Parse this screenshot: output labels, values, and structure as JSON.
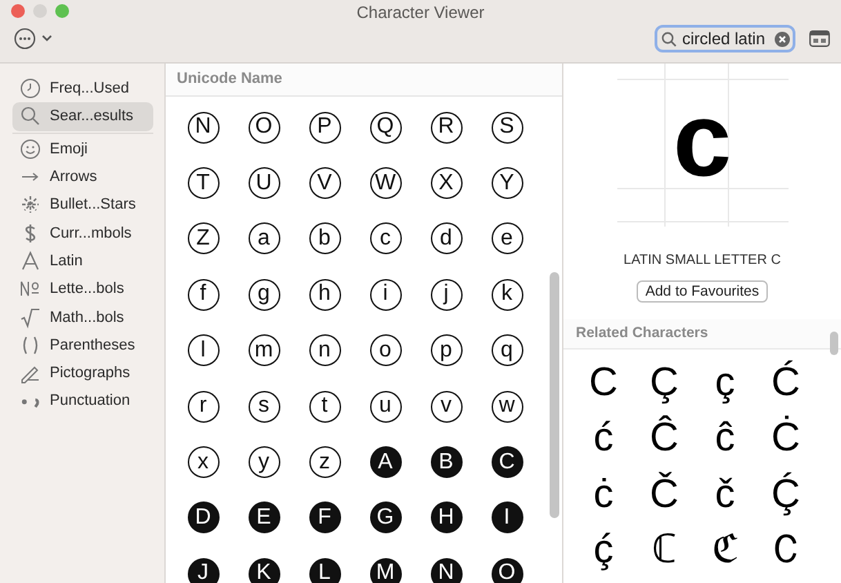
{
  "window": {
    "title": "Character Viewer"
  },
  "toolbar": {
    "search": {
      "value": "circled latin"
    }
  },
  "sidebar": {
    "items": [
      {
        "label": "Freq...Used",
        "kind": "clock",
        "selected": false
      },
      {
        "label": "Sear...esults",
        "kind": "search",
        "selected": true
      },
      {
        "label": "Emoji",
        "kind": "smiley",
        "selected": false
      },
      {
        "label": "Arrows",
        "kind": "arrow",
        "selected": false
      },
      {
        "label": "Bullet...Stars",
        "kind": "asterisk",
        "selected": false
      },
      {
        "label": "Curr...mbols",
        "kind": "dollar",
        "selected": false
      },
      {
        "label": "Latin",
        "kind": "letter",
        "selected": false
      },
      {
        "label": "Lette...bols",
        "kind": "numero",
        "selected": false
      },
      {
        "label": "Math...bols",
        "kind": "root",
        "selected": false
      },
      {
        "label": "Parentheses",
        "kind": "parens",
        "selected": false
      },
      {
        "label": "Pictographs",
        "kind": "pencil",
        "selected": false
      },
      {
        "label": "Punctuation",
        "kind": "punct",
        "selected": false
      }
    ]
  },
  "results": {
    "header": "Unicode Name",
    "characters": [
      {
        "char": "N",
        "kind": "outline"
      },
      {
        "char": "O",
        "kind": "outline"
      },
      {
        "char": "P",
        "kind": "outline"
      },
      {
        "char": "Q",
        "kind": "outline"
      },
      {
        "char": "R",
        "kind": "outline"
      },
      {
        "char": "S",
        "kind": "outline"
      },
      {
        "char": "T",
        "kind": "outline"
      },
      {
        "char": "U",
        "kind": "outline"
      },
      {
        "char": "V",
        "kind": "outline"
      },
      {
        "char": "W",
        "kind": "outline"
      },
      {
        "char": "X",
        "kind": "outline"
      },
      {
        "char": "Y",
        "kind": "outline"
      },
      {
        "char": "Z",
        "kind": "outline"
      },
      {
        "char": "a",
        "kind": "outline"
      },
      {
        "char": "b",
        "kind": "outline"
      },
      {
        "char": "c",
        "kind": "outline"
      },
      {
        "char": "d",
        "kind": "outline"
      },
      {
        "char": "e",
        "kind": "outline"
      },
      {
        "char": "f",
        "kind": "outline"
      },
      {
        "char": "g",
        "kind": "outline"
      },
      {
        "char": "h",
        "kind": "outline"
      },
      {
        "char": "i",
        "kind": "outline"
      },
      {
        "char": "j",
        "kind": "outline"
      },
      {
        "char": "k",
        "kind": "outline"
      },
      {
        "char": "l",
        "kind": "outline"
      },
      {
        "char": "m",
        "kind": "outline"
      },
      {
        "char": "n",
        "kind": "outline"
      },
      {
        "char": "o",
        "kind": "outline"
      },
      {
        "char": "p",
        "kind": "outline"
      },
      {
        "char": "q",
        "kind": "outline"
      },
      {
        "char": "r",
        "kind": "outline"
      },
      {
        "char": "s",
        "kind": "outline"
      },
      {
        "char": "t",
        "kind": "outline"
      },
      {
        "char": "u",
        "kind": "outline"
      },
      {
        "char": "v",
        "kind": "outline"
      },
      {
        "char": "w",
        "kind": "outline"
      },
      {
        "char": "x",
        "kind": "outline"
      },
      {
        "char": "y",
        "kind": "outline"
      },
      {
        "char": "z",
        "kind": "outline"
      },
      {
        "char": "A",
        "kind": "filled"
      },
      {
        "char": "B",
        "kind": "filled"
      },
      {
        "char": "C",
        "kind": "filled"
      },
      {
        "char": "D",
        "kind": "filled"
      },
      {
        "char": "E",
        "kind": "filled"
      },
      {
        "char": "F",
        "kind": "filled"
      },
      {
        "char": "G",
        "kind": "filled"
      },
      {
        "char": "H",
        "kind": "filled"
      },
      {
        "char": "I",
        "kind": "filled"
      },
      {
        "char": "J",
        "kind": "filled"
      },
      {
        "char": "K",
        "kind": "filled"
      },
      {
        "char": "L",
        "kind": "filled"
      },
      {
        "char": "M",
        "kind": "filled"
      },
      {
        "char": "N",
        "kind": "filled"
      },
      {
        "char": "O",
        "kind": "filled"
      }
    ]
  },
  "detail": {
    "glyph": "c",
    "name": "LATIN SMALL LETTER C",
    "button": "Add to Favourites",
    "related_header": "Related Characters",
    "related": [
      "C",
      "Ç",
      "ç",
      "Ć",
      "ć",
      "Ĉ",
      "ĉ",
      "Ċ",
      "ċ",
      "Č",
      "č",
      "Ḉ",
      "ḉ",
      "ℂ",
      "ℭ",
      "Ｃ"
    ]
  }
}
